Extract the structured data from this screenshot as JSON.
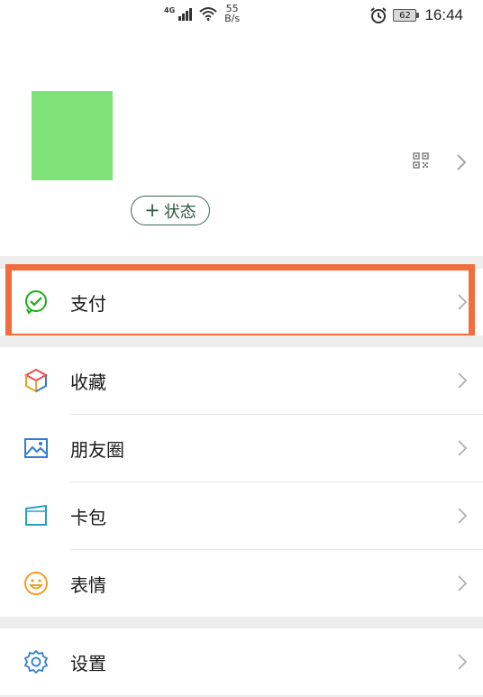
{
  "status_bar": {
    "network": "4G",
    "speed_value": "55",
    "speed_unit": "B/s",
    "battery": "62",
    "time": "16:44"
  },
  "profile": {
    "status_button": "状态",
    "status_plus": "+"
  },
  "menu": {
    "pay": "支付",
    "favorites": "收藏",
    "moments": "朋友圈",
    "cards": "卡包",
    "stickers": "表情",
    "settings": "设置"
  },
  "colors": {
    "highlight": "#f26d3d",
    "avatar": "#7fe37a",
    "pay_icon": "#1aad19",
    "moments_icon": "#2f7fd1",
    "cards_icon": "#2aa0c0",
    "stickers_icon": "#f0a028",
    "settings_icon": "#2f7fd1"
  }
}
